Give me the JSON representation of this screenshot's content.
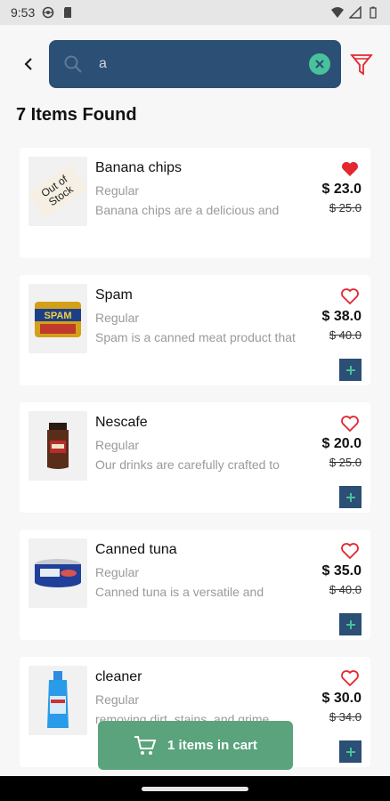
{
  "status_bar": {
    "time": "9:53"
  },
  "search": {
    "value": "a",
    "placeholder": ""
  },
  "results": {
    "title": "7 Items Found"
  },
  "cart": {
    "label": "1 items in cart"
  },
  "colors": {
    "primary": "#2b4f75",
    "accent": "#49c19a",
    "cart": "#5aa37c",
    "heart": "#e3262f"
  },
  "products": [
    {
      "name": "Banana chips",
      "variant": "Regular",
      "description": "Banana chips are a delicious and",
      "price": "$ 23.0",
      "old_price": "$ 25.0",
      "favorite": true,
      "out_of_stock": true,
      "out_of_stock_label": "Out of Stock",
      "image_icon": "out-of-stock-image"
    },
    {
      "name": "Spam",
      "variant": "Regular",
      "description": "Spam is a canned meat product that",
      "price": "$ 38.0",
      "old_price": "$ 40.0",
      "favorite": false,
      "out_of_stock": false,
      "can_label": "SPAM",
      "image_icon": "spam-can-image"
    },
    {
      "name": "Nescafe",
      "variant": "Regular",
      "description": "Our drinks are carefully crafted to",
      "price": "$ 20.0",
      "old_price": "$ 25.0",
      "favorite": false,
      "out_of_stock": false,
      "image_icon": "coffee-jar-image"
    },
    {
      "name": "Canned tuna",
      "variant": "Regular",
      "description": "Canned tuna is a versatile and",
      "price": "$ 35.0",
      "old_price": "$ 40.0",
      "favorite": false,
      "out_of_stock": false,
      "image_icon": "tuna-can-image"
    },
    {
      "name": "cleaner",
      "variant": "Regular",
      "description": "removing dirt, stains, and grime",
      "price": "$ 30.0",
      "old_price": "$ 34.0",
      "favorite": false,
      "out_of_stock": false,
      "image_icon": "cleaner-bottle-image"
    }
  ]
}
